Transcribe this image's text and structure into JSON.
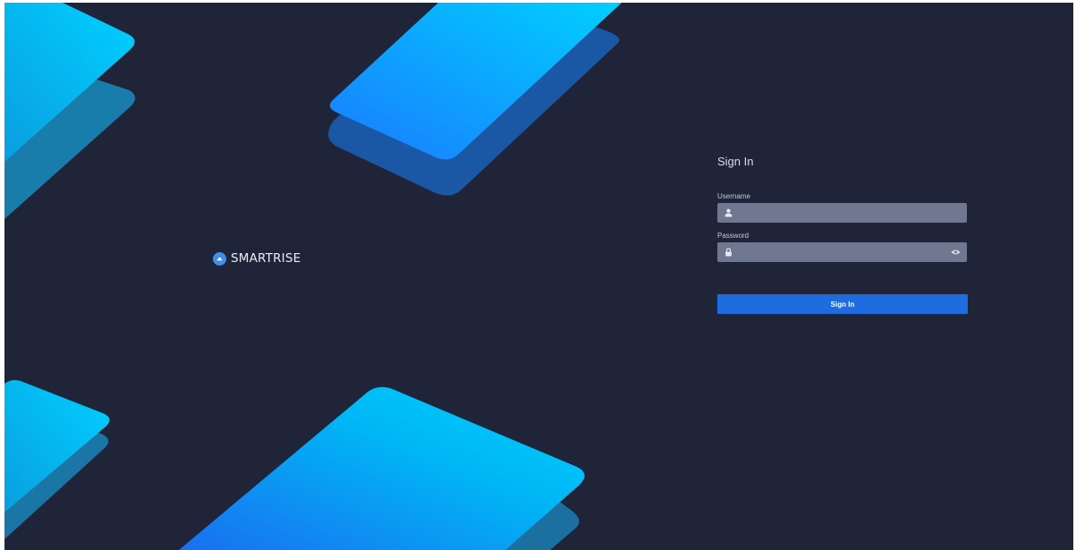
{
  "brand": {
    "name": "SMARTRISE",
    "logo_icon": "chevron-up-icon"
  },
  "login": {
    "title": "Sign In",
    "username": {
      "label": "Username",
      "value": "",
      "placeholder": "",
      "icon": "user-icon"
    },
    "password": {
      "label": "Password",
      "value": "",
      "placeholder": "",
      "icon": "lock-icon",
      "toggle_icon": "eye-icon"
    },
    "submit_label": "Sign In"
  },
  "colors": {
    "background": "#1f2438",
    "input_fill": "#6f7890",
    "button": "#1e6de0",
    "accent_cyan": "#00c8ff",
    "accent_blue": "#1e6de0"
  }
}
